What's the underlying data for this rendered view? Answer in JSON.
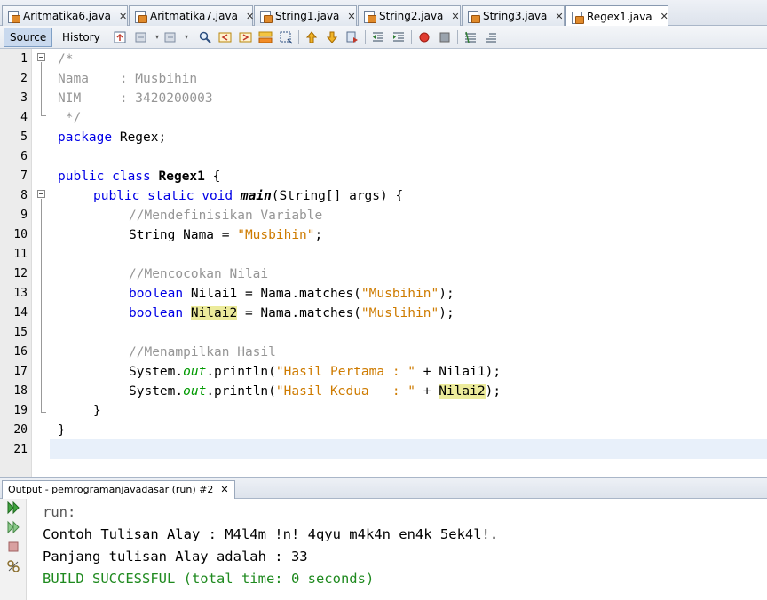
{
  "tabs": [
    {
      "label": "Aritmatika6.java",
      "active": false
    },
    {
      "label": "Aritmatika7.java",
      "active": false
    },
    {
      "label": "String1.java",
      "active": false
    },
    {
      "label": "String2.java",
      "active": false
    },
    {
      "label": "String3.java",
      "active": false
    },
    {
      "label": "Regex1.java",
      "active": true
    }
  ],
  "close_glyph": "✕",
  "toolbar": {
    "source_label": "Source",
    "history_label": "History"
  },
  "line_numbers": [
    "1",
    "2",
    "3",
    "4",
    "5",
    "6",
    "7",
    "8",
    "9",
    "10",
    "11",
    "12",
    "13",
    "14",
    "15",
    "16",
    "17",
    "18",
    "19",
    "20",
    "21"
  ],
  "code": {
    "l1": "/*",
    "l2": "Nama    : Musbihin",
    "l3": "NIM     : 3420200003",
    "l4": " */",
    "l5_kw": "package",
    "l5_rest": " Regex;",
    "l7_kw": "public class",
    "l7_name": "Regex1",
    "l7_rest": " {",
    "l8_kw": "public static void",
    "l8_name": "main",
    "l8_rest": "(String[] args) {",
    "l9": "//Mendefinisikan Variable",
    "l10_a": "String Nama = ",
    "l10_str": "\"Musbihin\"",
    "l10_b": ";",
    "l12": "//Mencocokan Nilai",
    "l13_kw": "boolean",
    "l13_a": " Nilai1 = Nama.matches(",
    "l13_str": "\"Musbihin\"",
    "l13_b": ");",
    "l14_kw": "boolean",
    "l14_var": "Nilai2",
    "l14_a": " = Nama.matches(",
    "l14_str": "\"Muslihin\"",
    "l14_b": ");",
    "l16": "//Menampilkan Hasil",
    "l17_a": "System.",
    "l17_out": "out",
    "l17_b": ".println(",
    "l17_str": "\"Hasil Pertama : \"",
    "l17_c": " + Nilai1);",
    "l18_a": "System.",
    "l18_out": "out",
    "l18_b": ".println(",
    "l18_str": "\"Hasil Kedua   : \"",
    "l18_c": " + ",
    "l18_var": "Nilai2",
    "l18_d": ");",
    "l19": "}",
    "l20": "}"
  },
  "output": {
    "tab_label": "Output - pemrogramanjavadasar (run) #2",
    "lines": [
      "run:",
      "Contoh Tulisan Alay : M4l4m !n! 4qyu m4k4n en4k 5ek4l!.",
      "Panjang tulisan Alay adalah : 33",
      "BUILD SUCCESSFUL (total time: 0 seconds)"
    ]
  },
  "colors": {
    "keyword": "#0000e6",
    "string": "#ce7b00",
    "comment": "#969696",
    "field": "#009900",
    "highlight": "#eceb9b",
    "build_success": "#1f8a1f"
  }
}
